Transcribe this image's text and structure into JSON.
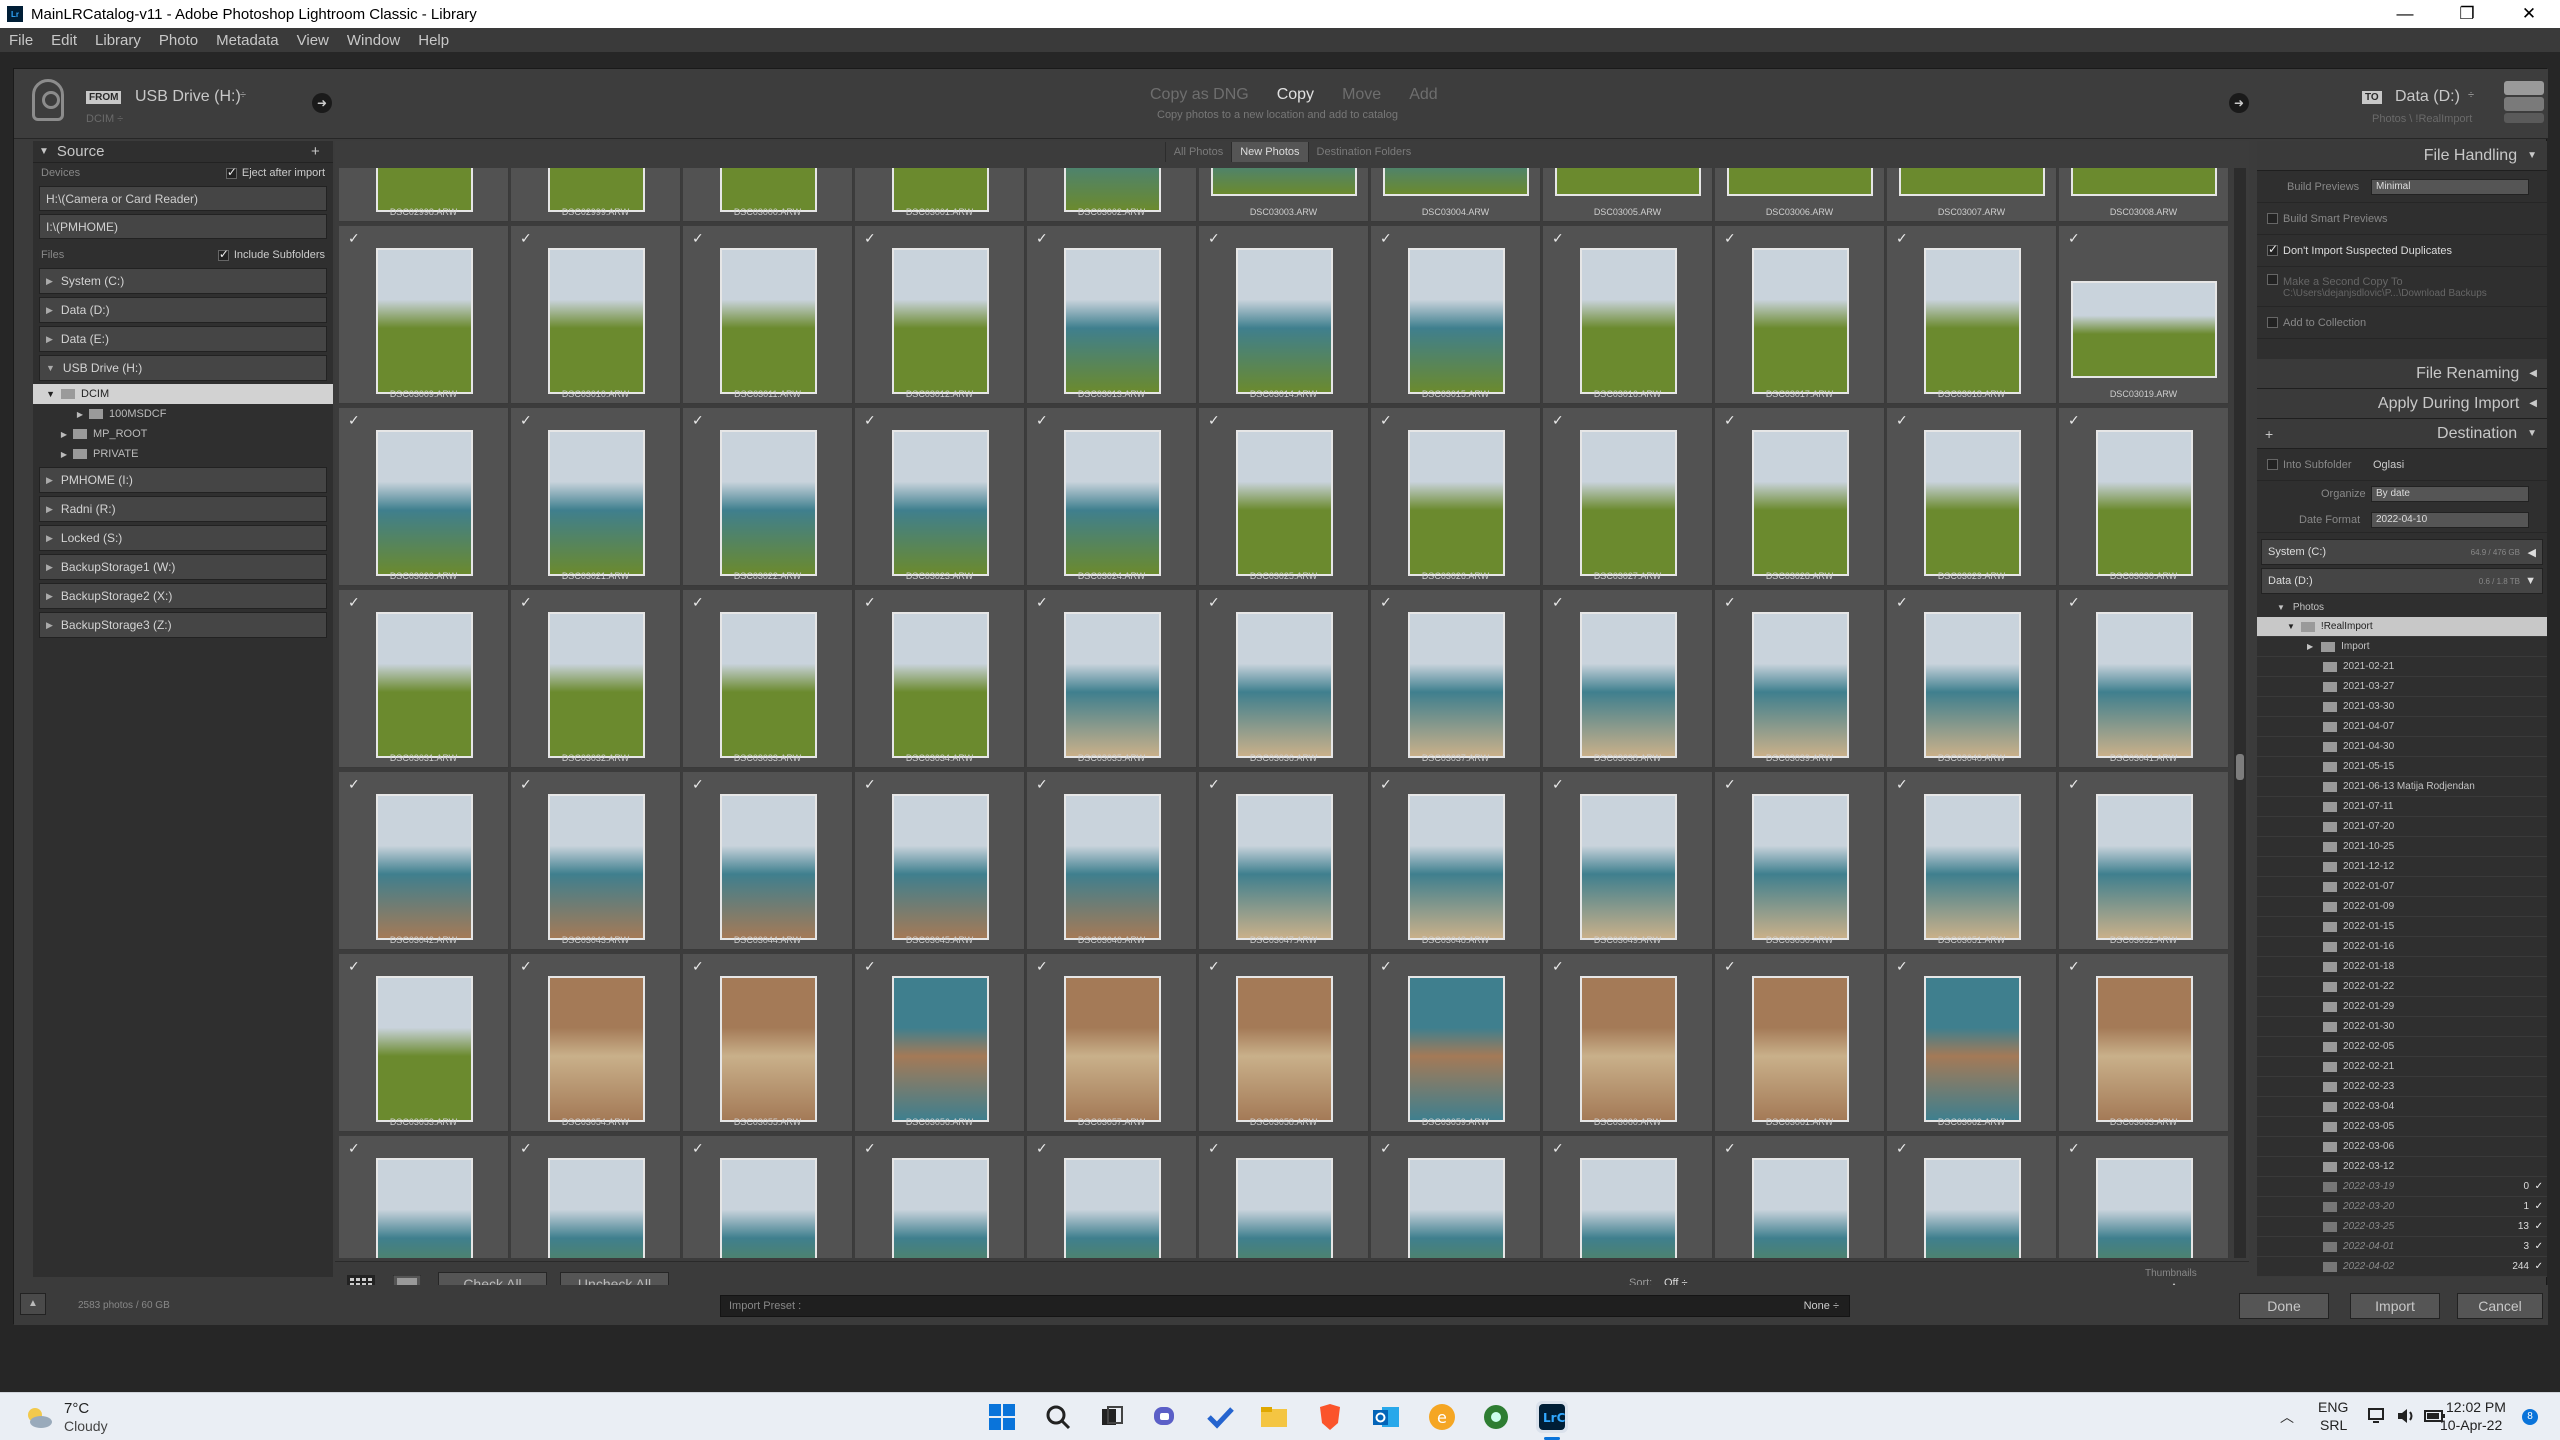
{
  "window": {
    "title": "MainLRCatalog-v11 - Adobe Photoshop Lightroom Classic - Library",
    "minimize": "—",
    "maximize": "❐",
    "close": "✕"
  },
  "menu": [
    "File",
    "Edit",
    "Library",
    "Photo",
    "Metadata",
    "View",
    "Window",
    "Help"
  ],
  "import": {
    "from_label": "FROM",
    "source_name": "USB Drive (H:)",
    "source_path": "DCIM ÷",
    "modes": [
      "Copy as DNG",
      "Copy",
      "Move",
      "Add"
    ],
    "active_mode": "Copy",
    "mode_desc": "Copy photos to a new location and add to catalog",
    "to_label": "TO",
    "dest_name": "Data (D:)",
    "dest_path": "Photos \\ !RealImport"
  },
  "source": {
    "title": "Source",
    "add": "+",
    "devices_label": "Devices",
    "eject": "Eject after import",
    "paths": [
      "H:\\(Camera or Card Reader)",
      "I:\\(PMHOME)"
    ],
    "files_label": "Files",
    "include_sub": "Include Subfolders",
    "drives_before": [
      "System (C:)",
      "Data (D:)",
      "Data (E:)"
    ],
    "usb": "USB Drive (H:)",
    "dcim": "DCIM",
    "subfolders": [
      "100MSDCF",
      "MP_ROOT",
      "PRIVATE"
    ],
    "drives_after": [
      "PMHOME (I:)",
      "Radni (R:)",
      "Locked (S:)",
      "BackupStorage1 (W:)",
      "BackupStorage2 (X:)",
      "BackupStorage3 (Z:)"
    ]
  },
  "tabs": [
    "All Photos",
    "New Photos",
    "Destination Folders"
  ],
  "grid": {
    "row0": [
      "DSC02998.ARW",
      "DSC02999.ARW",
      "DSC03000.ARW",
      "DSC03001.ARW",
      "DSC03002.ARW",
      "DSC03003.ARW",
      "DSC03004.ARW",
      "DSC03005.ARW",
      "DSC03006.ARW",
      "DSC03007.ARW",
      "DSC03008.ARW"
    ],
    "row1": [
      "DSC03009.ARW",
      "DSC03010.ARW",
      "DSC03011.ARW",
      "DSC03012.ARW",
      "DSC03013.ARW",
      "DSC03014.ARW",
      "DSC03015.ARW",
      "DSC03016.ARW",
      "DSC03017.ARW",
      "DSC03018.ARW",
      "DSC03019.ARW"
    ],
    "row2": [
      "DSC03020.ARW",
      "DSC03021.ARW",
      "DSC03022.ARW",
      "DSC03023.ARW",
      "DSC03024.ARW",
      "DSC03025.ARW",
      "DSC03026.ARW",
      "DSC03027.ARW",
      "DSC03028.ARW",
      "DSC03029.ARW",
      "DSC03030.ARW"
    ],
    "row3": [
      "DSC03031.ARW",
      "DSC03032.ARW",
      "DSC03033.ARW",
      "DSC03034.ARW",
      "DSC03035.ARW",
      "DSC03036.ARW",
      "DSC03037.ARW",
      "DSC03038.ARW",
      "DSC03039.ARW",
      "DSC03040.ARW",
      "DSC03041.ARW"
    ],
    "row4": [
      "DSC03042.ARW",
      "DSC03043.ARW",
      "DSC03044.ARW",
      "DSC03045.ARW",
      "DSC03046.ARW",
      "DSC03047.ARW",
      "DSC03048.ARW",
      "DSC03049.ARW",
      "DSC03050.ARW",
      "DSC03051.ARW",
      "DSC03052.ARW"
    ],
    "row5": [
      "DSC03053.ARW",
      "DSC03054.ARW",
      "DSC03055.ARW",
      "DSC03056.ARW",
      "DSC03057.ARW",
      "DSC03058.ARW",
      "DSC03059.ARW",
      "DSC03060.ARW",
      "DSC03061.ARW",
      "DSC03062.ARW",
      "DSC03063.ARW"
    ]
  },
  "toolbar": {
    "check_all": "Check All",
    "uncheck_all": "Uncheck All",
    "sort_label": "Sort:",
    "sort_value": "Off ÷",
    "thumbnails": "Thumbnails"
  },
  "file_handling": {
    "title": "File Handling",
    "build_previews": "Build Previews",
    "build_value": "Minimal",
    "smart": "Build Smart Previews",
    "dupes": "Don't Import Suspected Duplicates",
    "second_copy": "Make a Second Copy To",
    "second_path": "C:\\Users\\dejanjsdlovic\\P...\\Download Backups",
    "collection": "Add to Collection"
  },
  "sections": {
    "renaming": "File Renaming",
    "apply": "Apply During Import",
    "destination": "Destination"
  },
  "destination": {
    "subfolder": "Into Subfolder",
    "subfolder_name": "Oglasi",
    "organize": "Organize",
    "organize_value": "By date",
    "date_format": "Date Format",
    "date_value": "2022-04-10",
    "system": "System (C:)",
    "system_size": "64.9 / 476 GB",
    "data": "Data (D:)",
    "data_size": "0.6 / 1.8 TB",
    "photos": "Photos",
    "realimport": "!RealImport",
    "import": "Import",
    "folders": [
      "2021-02-21",
      "2021-03-27",
      "2021-03-30",
      "2021-04-07",
      "2021-04-30",
      "2021-05-15",
      "2021-06-13 Matija Rodjendan",
      "2021-07-11",
      "2021-07-20",
      "2021-10-25",
      "2021-12-12",
      "2022-01-07",
      "2022-01-09",
      "2022-01-15",
      "2022-01-16",
      "2022-01-18",
      "2022-01-22",
      "2022-01-29",
      "2022-01-30",
      "2022-02-05",
      "2022-02-21",
      "2022-02-23",
      "2022-03-04",
      "2022-03-05",
      "2022-03-06",
      "2022-03-12"
    ],
    "new_folders": [
      {
        "name": "2022-03-19",
        "count": "0"
      },
      {
        "name": "2022-03-20",
        "count": "1"
      },
      {
        "name": "2022-03-25",
        "count": "13"
      },
      {
        "name": "2022-04-01",
        "count": "3"
      },
      {
        "name": "2022-04-02",
        "count": "244"
      }
    ]
  },
  "footer": {
    "summary": "2583 photos / 60 GB",
    "preset_label": "Import Preset :",
    "preset_value": "None ÷",
    "done": "Done",
    "import": "Import",
    "cancel": "Cancel"
  },
  "taskbar": {
    "temp": "7°C",
    "weather": "Cloudy",
    "lang1": "ENG",
    "lang2": "SRL",
    "time": "12:02 PM",
    "date": "10-Apr-22",
    "badge": "8"
  },
  "colors": {
    "sky": "#c9d3dc",
    "sea": "#3f7f8e",
    "grass": "#6b8a2e",
    "rock": "#a47a57",
    "sand": "#c9b08a"
  }
}
